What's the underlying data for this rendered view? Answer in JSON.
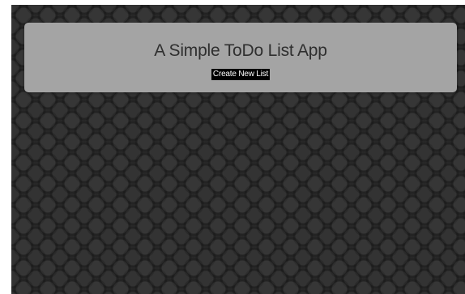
{
  "header": {
    "title": "A Simple ToDo List App",
    "create_button_label": "Create New List"
  },
  "colors": {
    "background": "#2b2b2b",
    "card": "#a4a4a4",
    "title_text": "#2f2f2f",
    "button_bg": "#000000",
    "button_text": "#ffffff"
  }
}
